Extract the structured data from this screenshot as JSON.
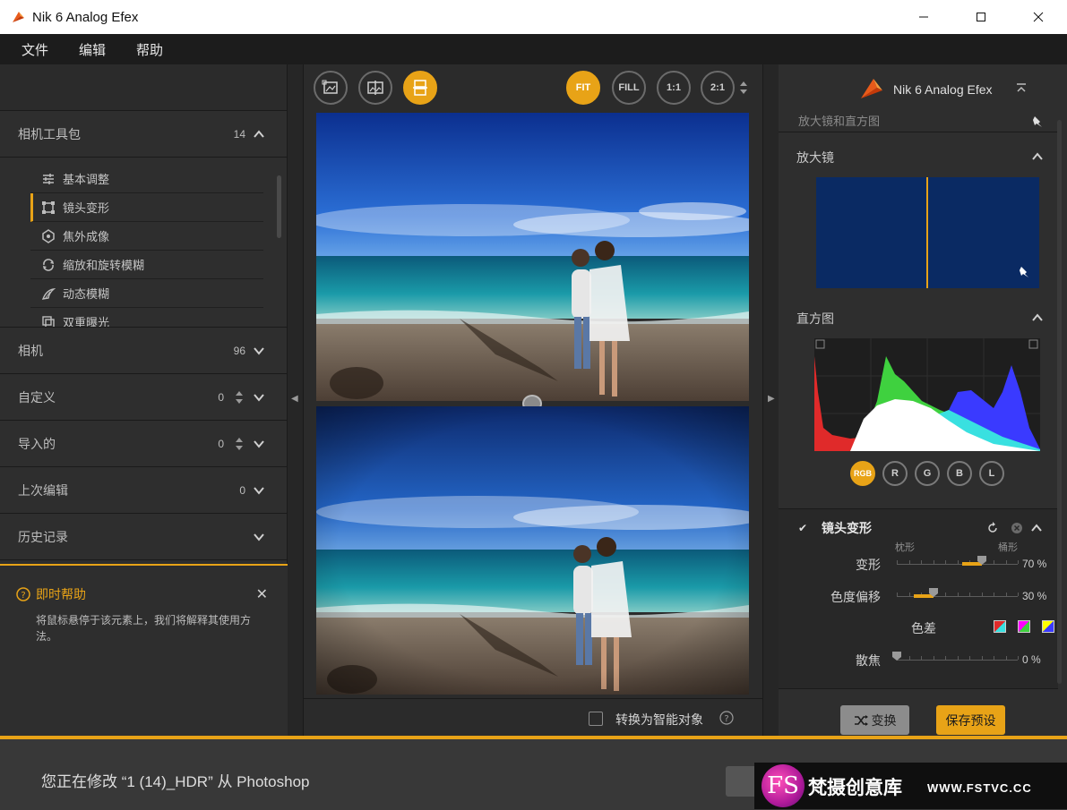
{
  "window": {
    "title": "Nik 6 Analog Efex",
    "controls": [
      "minimize",
      "maximize",
      "close"
    ]
  },
  "menu": [
    "文件",
    "编辑",
    "帮助"
  ],
  "left": {
    "camera_toolkit": {
      "label": "相机工具包",
      "count": "14"
    },
    "tools": [
      {
        "label": "基本调整",
        "icon": "sliders-icon",
        "active": false
      },
      {
        "label": "镜头变形",
        "icon": "crop-frame-icon",
        "active": true
      },
      {
        "label": "焦外成像",
        "icon": "bokeh-icon",
        "active": false
      },
      {
        "label": "缩放和旋转模糊",
        "icon": "rotate-icon",
        "active": false
      },
      {
        "label": "动态模糊",
        "icon": "motion-icon",
        "active": false
      },
      {
        "label": "双重曝光",
        "icon": "double-exposure-icon",
        "active": false
      }
    ],
    "sections": [
      {
        "label": "相机",
        "count": "96",
        "updown": false
      },
      {
        "label": "自定义",
        "count": "0",
        "updown": true
      },
      {
        "label": "导入的",
        "count": "0",
        "updown": true
      },
      {
        "label": "上次编辑",
        "count": "0",
        "updown": false
      },
      {
        "label": "历史记录",
        "count": "",
        "updown": false
      }
    ],
    "help": {
      "title": "即时帮助",
      "body": "将鼠标悬停于该元素上，我们将解释其使用方法。"
    }
  },
  "center": {
    "view_buttons": [
      "single-view-icon",
      "side-by-side-icon",
      "split-view-icon"
    ],
    "zoom": {
      "options": [
        "FIT",
        "FILL",
        "1:1",
        "2:1"
      ],
      "selected": "FIT"
    },
    "smart_object_label": "转换为智能对象"
  },
  "right": {
    "brand": "Nik 6 Analog Efex",
    "subhead": "放大镜和直方图",
    "loupe_title": "放大镜",
    "histogram_title": "直方图",
    "channels": [
      "RGB",
      "R",
      "G",
      "B",
      "L"
    ],
    "selected_channel": "RGB",
    "filter": {
      "title": "镜头变形",
      "checked": true,
      "tag_left": "枕形",
      "tag_right": "桶形",
      "sliders": [
        {
          "label": "变形",
          "value": 70,
          "display": "70 %"
        },
        {
          "label": "色度偏移",
          "value": 30,
          "display": "30 %"
        },
        {
          "label": "散焦",
          "value": 0,
          "display": "0 %"
        }
      ],
      "chromatic_label": "色差",
      "chromatic_colors": [
        "#e8e8e8",
        "#ff00ff",
        "#ffff00"
      ]
    },
    "swap_label": "变换",
    "save_preset_label": "保存预设"
  },
  "footer": {
    "status": "您正在修改 “1 (14)_HDR” 从 Photoshop"
  },
  "watermark": {
    "logo": "FS",
    "text": "梵摄创意库",
    "url": "WWW.FSTVC.CC"
  },
  "colors": {
    "accent": "#e8a317",
    "bg": "#2b2b2b"
  }
}
